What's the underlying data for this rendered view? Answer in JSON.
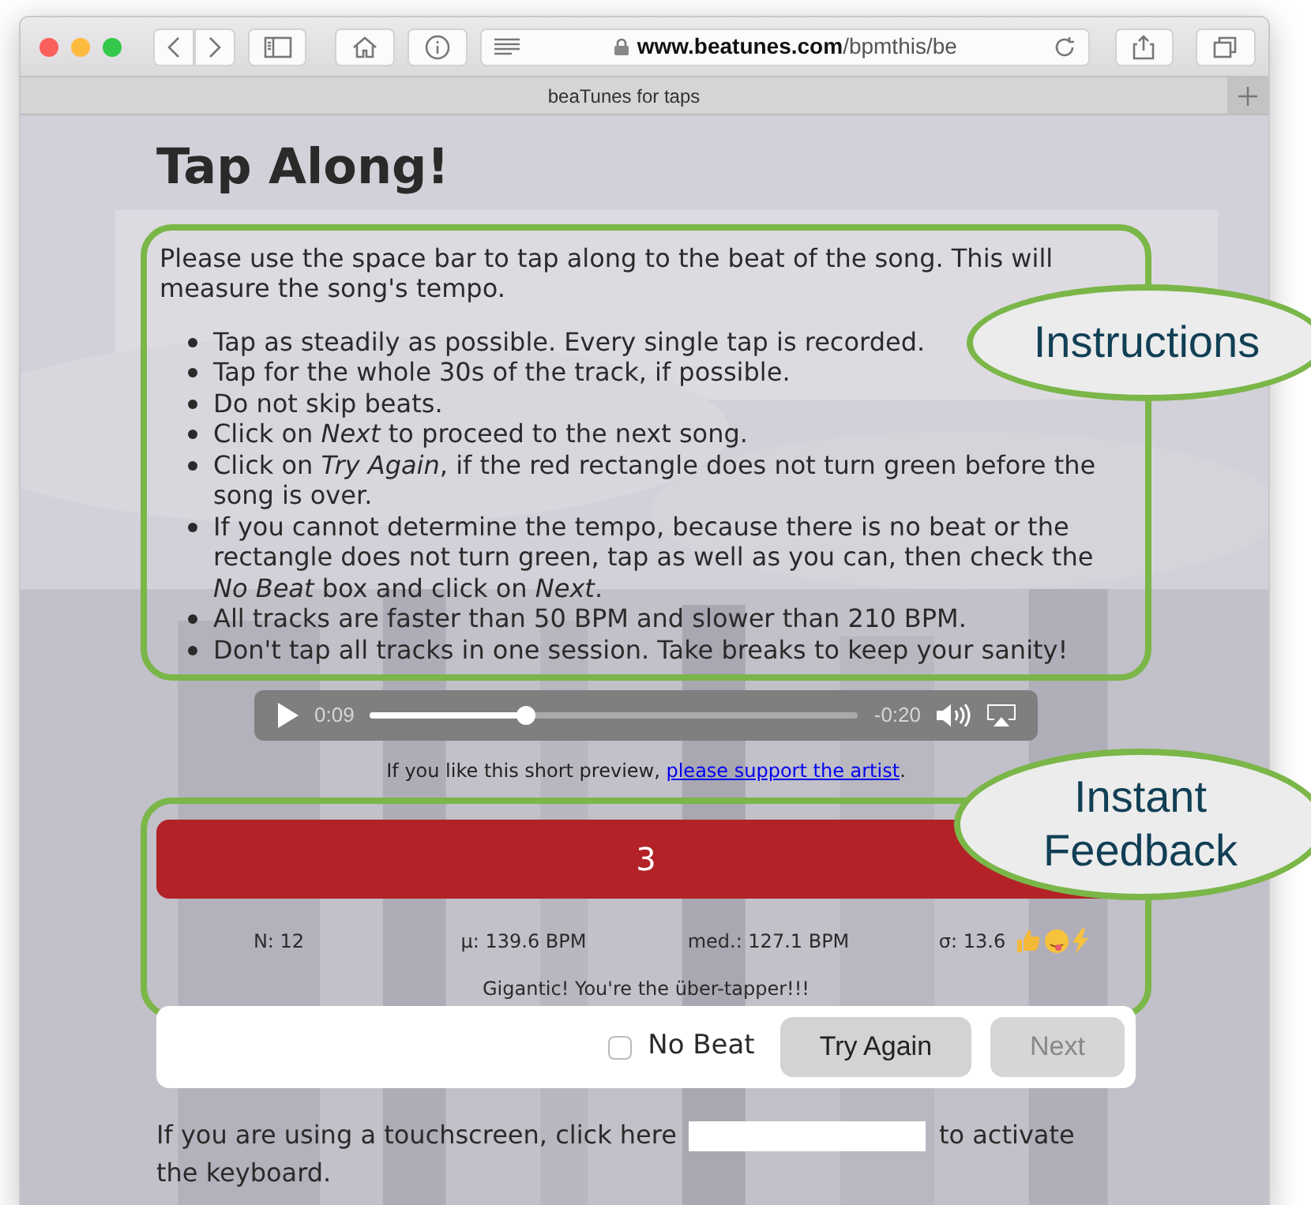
{
  "browser": {
    "url_host": "www.beatunes.com",
    "url_path": "/bpmthis/be",
    "tab_title": "beaTunes for taps"
  },
  "page": {
    "title": "Tap Along!",
    "instructions": {
      "intro": "Please use the space bar to tap along to the beat of the song. This will measure the song's tempo.",
      "bullets": [
        "Tap as steadily as possible. Every single tap is recorded.",
        "Tap for the whole 30s of the track, if possible.",
        "Do not skip beats.",
        "Click on *Next* to proceed to the next song.",
        "Click on *Try Again*, if the red rectangle does not turn green before the song is over.",
        "If you cannot determine the tempo, because there is no beat or the rectangle does not turn green, tap as well as you can, then check the *No Beat* box and click on *Next*.",
        "All tracks are faster than 50 BPM and slower than 210 BPM.",
        "Don't tap all tracks in one session. Take breaks to keep your sanity!"
      ]
    },
    "player": {
      "elapsed": "0:09",
      "remaining": "-0:20",
      "level": 0.32
    },
    "support": {
      "text": "If you like this short preview, ",
      "link": "please support the artist",
      "after": "."
    },
    "feedback": {
      "count": "3",
      "stats": [
        "N: 12",
        "μ: 139.6 BPM",
        "med.: 127.1 BPM",
        "σ: 13.6"
      ],
      "message": "Gigantic! You're the über-tapper!!!"
    },
    "no_beat": {
      "label": "No Beat",
      "checked": false
    },
    "buttons": [
      {
        "label": "Try Again",
        "disabled": false
      },
      {
        "label": "Next",
        "disabled": true
      }
    ],
    "touch": {
      "before": "If you are using a touchscreen, click here",
      "after": "to activate",
      "after_line_2": "the keyboard."
    }
  },
  "callouts": [
    {
      "text": "Instructions"
    },
    {
      "text": "Instant Feedback"
    }
  ]
}
